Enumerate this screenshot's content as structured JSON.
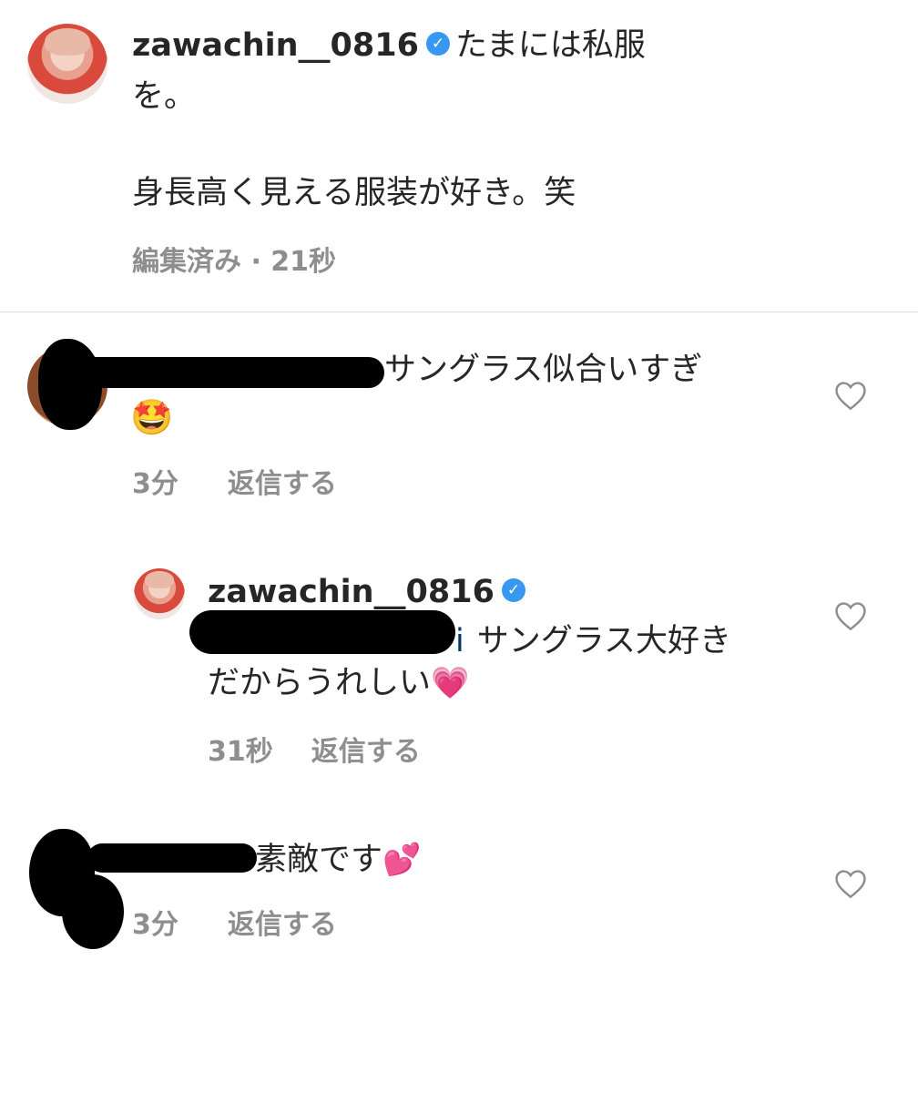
{
  "caption": {
    "username": "zawachin__0816",
    "text_line1": "たまには私服",
    "text_line2": "を。",
    "text_line3": "身長高く見える服装が好き。笑",
    "meta": "編集済み · 21秒"
  },
  "comments": [
    {
      "text": "サングラス似合いすぎ",
      "emoji": "🤩",
      "time": "3分",
      "reply_label": "返信する"
    },
    {
      "username": "zawachin__0816",
      "mention_tail": "i",
      "text_line1": "サングラス大好き",
      "text_line2": "だからうれしい",
      "emoji": "💗",
      "time": "31秒",
      "reply_label": "返信する"
    },
    {
      "text": "素敵です",
      "emoji": "💕",
      "time": "3分",
      "reply_label": "返信する"
    }
  ],
  "icons": {
    "verified": "verified-badge-icon",
    "like": "heart-outline-icon"
  },
  "colors": {
    "verified": "#3897f0",
    "meta_text": "#8e8e8e",
    "mention": "#00376b"
  }
}
